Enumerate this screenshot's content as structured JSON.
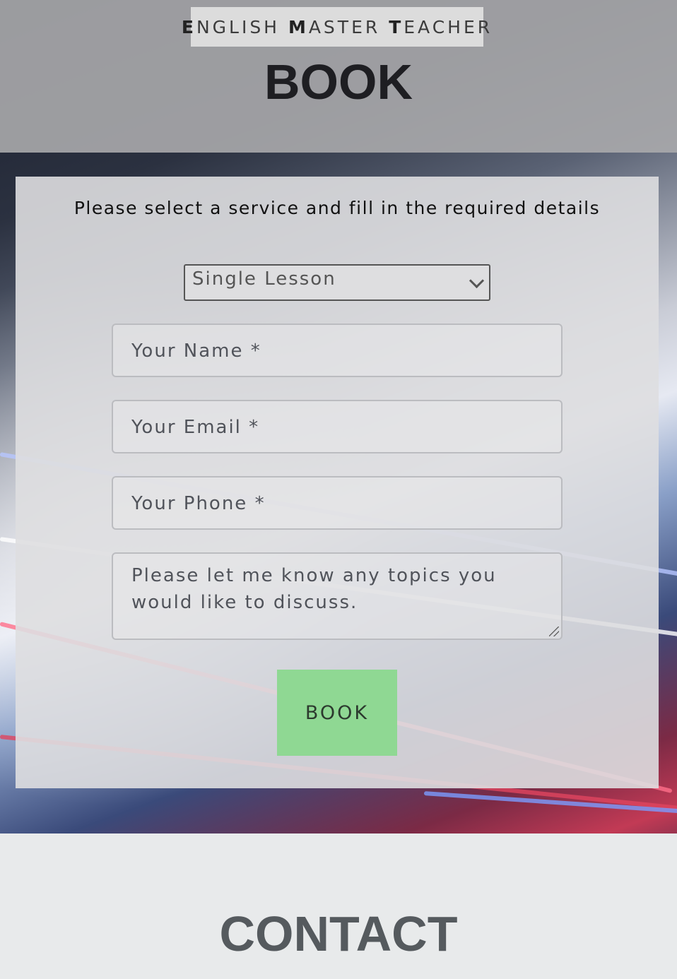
{
  "header": {
    "brand": {
      "first_initial": "E",
      "first_rest": "NGLISH ",
      "second_initial": "M",
      "second_rest": "ASTER ",
      "third_initial": "T",
      "third_rest": "EACHER"
    },
    "title": "BOOK"
  },
  "form": {
    "instructions": "Please select a service and fill in the required details",
    "service_select": {
      "selected": "Single Lesson"
    },
    "name": {
      "placeholder": "Your Name *"
    },
    "email": {
      "placeholder": "Your Email *"
    },
    "phone": {
      "placeholder": "Your Phone *"
    },
    "topics": {
      "placeholder": "Please let me know any topics you would like to discuss."
    },
    "submit_label": "BOOK"
  },
  "contact": {
    "title": "CONTACT"
  },
  "colors": {
    "button_green": "#8fd893",
    "card_bg": "#dedee0"
  }
}
